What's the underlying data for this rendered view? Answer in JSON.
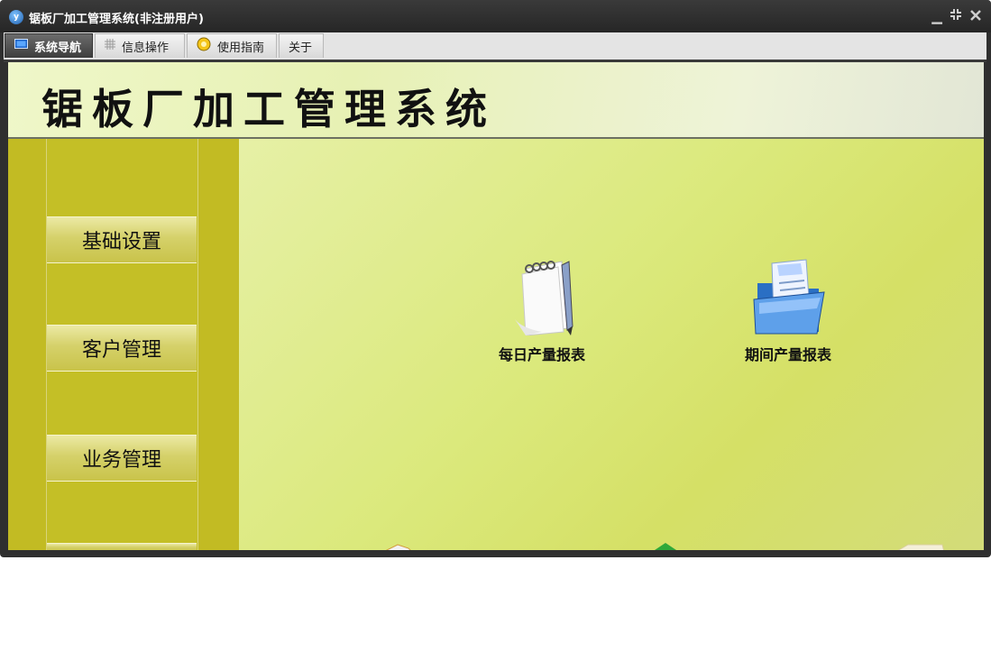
{
  "window": {
    "title": "锯板厂加工管理系统(非注册用户)",
    "app_icon": "app-logo-icon",
    "controls": [
      {
        "name": "minimize-icon",
        "glyph": "▁"
      },
      {
        "name": "restore-icon",
        "glyph": "⧉"
      },
      {
        "name": "close-icon",
        "glyph": "✕"
      }
    ]
  },
  "tabs": [
    {
      "label": "系统导航",
      "icon": "monitor-icon",
      "active": true
    },
    {
      "label": "信息操作",
      "icon": "grid-icon",
      "active": false
    },
    {
      "label": "使用指南",
      "icon": "compass-icon",
      "active": false
    },
    {
      "label": "关于",
      "icon": "",
      "active": false
    }
  ],
  "banner": {
    "title": "锯板厂加工管理系统"
  },
  "sidebar": {
    "items": [
      {
        "label": "基础设置"
      },
      {
        "label": "客户管理"
      },
      {
        "label": "业务管理"
      }
    ]
  },
  "main": {
    "features": [
      {
        "label": "每日产量报表",
        "icon": "notepad-icon"
      },
      {
        "label": "期间产量报表",
        "icon": "folder-document-icon"
      }
    ]
  },
  "colors": {
    "titlebar": "#2f2f2f",
    "sidebar": "#c2bb23",
    "main_bg": "#dbe97c"
  }
}
